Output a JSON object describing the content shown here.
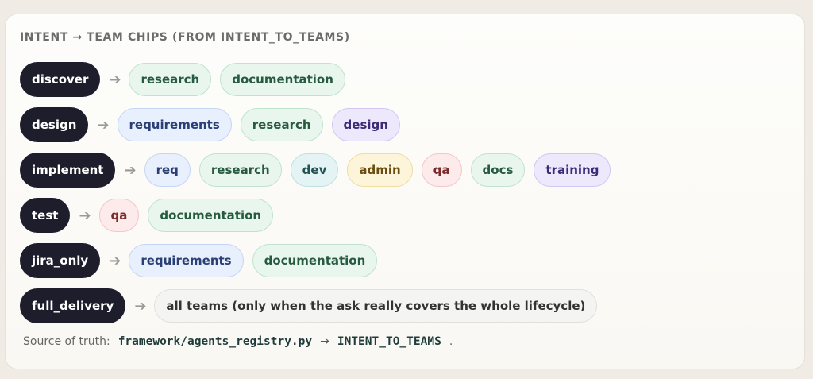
{
  "title": "INTENT → TEAM CHIPS (FROM INTENT_TO_TEAMS)",
  "arrow": "➔",
  "colors": {
    "intent_bg": "#1d1d2c",
    "green": "#e8f6ee",
    "blue": "#e8f0fd",
    "purple": "#eee8fc",
    "teal": "#e4f4f4",
    "yellow": "#fdf5da",
    "red": "#fdeaea",
    "grey": "#f4f4f2"
  },
  "rows": [
    {
      "intent": "discover",
      "teams": [
        {
          "label": "research",
          "tone": "green"
        },
        {
          "label": "documentation",
          "tone": "green"
        }
      ]
    },
    {
      "intent": "design",
      "teams": [
        {
          "label": "requirements",
          "tone": "blue"
        },
        {
          "label": "research",
          "tone": "green"
        },
        {
          "label": "design",
          "tone": "purple"
        }
      ]
    },
    {
      "intent": "implement",
      "teams": [
        {
          "label": "req",
          "tone": "blue"
        },
        {
          "label": "research",
          "tone": "green"
        },
        {
          "label": "dev",
          "tone": "teal"
        },
        {
          "label": "admin",
          "tone": "yellow"
        },
        {
          "label": "qa",
          "tone": "red"
        },
        {
          "label": "docs",
          "tone": "green"
        },
        {
          "label": "training",
          "tone": "purple"
        }
      ]
    },
    {
      "intent": "test",
      "teams": [
        {
          "label": "qa",
          "tone": "red"
        },
        {
          "label": "documentation",
          "tone": "green"
        }
      ]
    },
    {
      "intent": "jira_only",
      "teams": [
        {
          "label": "requirements",
          "tone": "blue"
        },
        {
          "label": "documentation",
          "tone": "green"
        }
      ]
    },
    {
      "intent": "full_delivery",
      "teams": [
        {
          "label": "all teams (only when the ask really covers the whole lifecycle)",
          "tone": "grey"
        }
      ]
    }
  ],
  "footer": {
    "prefix": "Source of truth:",
    "path": "framework/agents_registry.py",
    "arrow": "→",
    "symbol": "INTENT_TO_TEAMS",
    "suffix": "."
  }
}
